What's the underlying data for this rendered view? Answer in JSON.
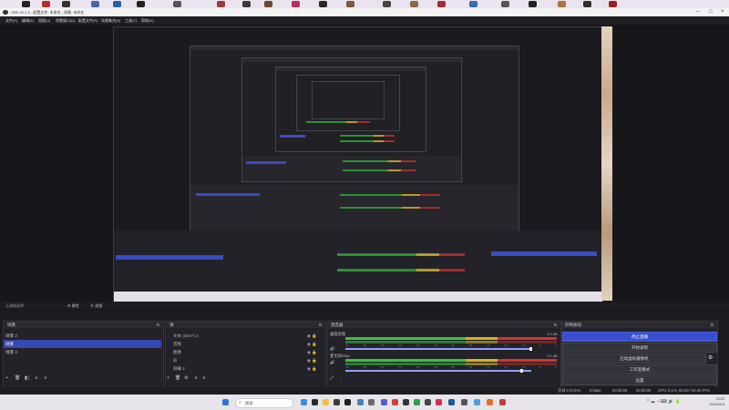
{
  "window": {
    "title": "OBS 30.2.3 - 配置文件: 未命名 - 场景: 未命名"
  },
  "menu": [
    "文件(F)",
    "编辑(E)",
    "视图(V)",
    "停靠窗口(D)",
    "配置文件(P)",
    "场景集合(S)",
    "工具(T)",
    "帮助(H)"
  ],
  "context_bar": {
    "no_source": "无源被选择",
    "properties": "属性",
    "filters": "滤镜"
  },
  "docks": {
    "scenes": {
      "title": "场景",
      "items": [
        {
          "label": "场景 2",
          "selected": false
        },
        {
          "label": "场景",
          "selected": true
        },
        {
          "label": "场景 3",
          "selected": false
        }
      ]
    },
    "sources": {
      "title": "源",
      "items": [
        "文本 (GDI+) 2",
        "音频",
        "图像",
        "彩",
        "屏幕 2"
      ]
    },
    "mixer": {
      "title": "混音器",
      "channels": [
        {
          "name": "桌面音频",
          "db": "0.0 dB"
        },
        {
          "name": "麦克风/Aux",
          "db": "0.0 dB"
        }
      ],
      "ticks": [
        "-60",
        "-55",
        "-50",
        "-45",
        "-40",
        "-35",
        "-30",
        "-25",
        "-20",
        "-15",
        "-10",
        "-5",
        "0"
      ]
    },
    "controls": {
      "title": "控制按钮",
      "buttons": [
        "停止直播",
        "开始录制",
        "启动虚拟摄像机",
        "工作室模式",
        "设置"
      ]
    }
  },
  "status": {
    "frames": "丢帧 0 (0.0%)",
    "bitrate": "0 kbps",
    "live_time": "00:00:00",
    "rec_time": "00:00:00",
    "cpu_fps": "CPU: 0.1%, 60.00 / 60.00 FPS"
  },
  "taskbar": {
    "search_placeholder": "搜索",
    "time": "10:22",
    "date": "2024/11/4"
  },
  "colors": {
    "accent": "#3a4fcf",
    "selected_scene": "#3548b4",
    "meter_green": "#3fbf45",
    "meter_yellow": "#d4b22f",
    "meter_red": "#cf3434"
  }
}
